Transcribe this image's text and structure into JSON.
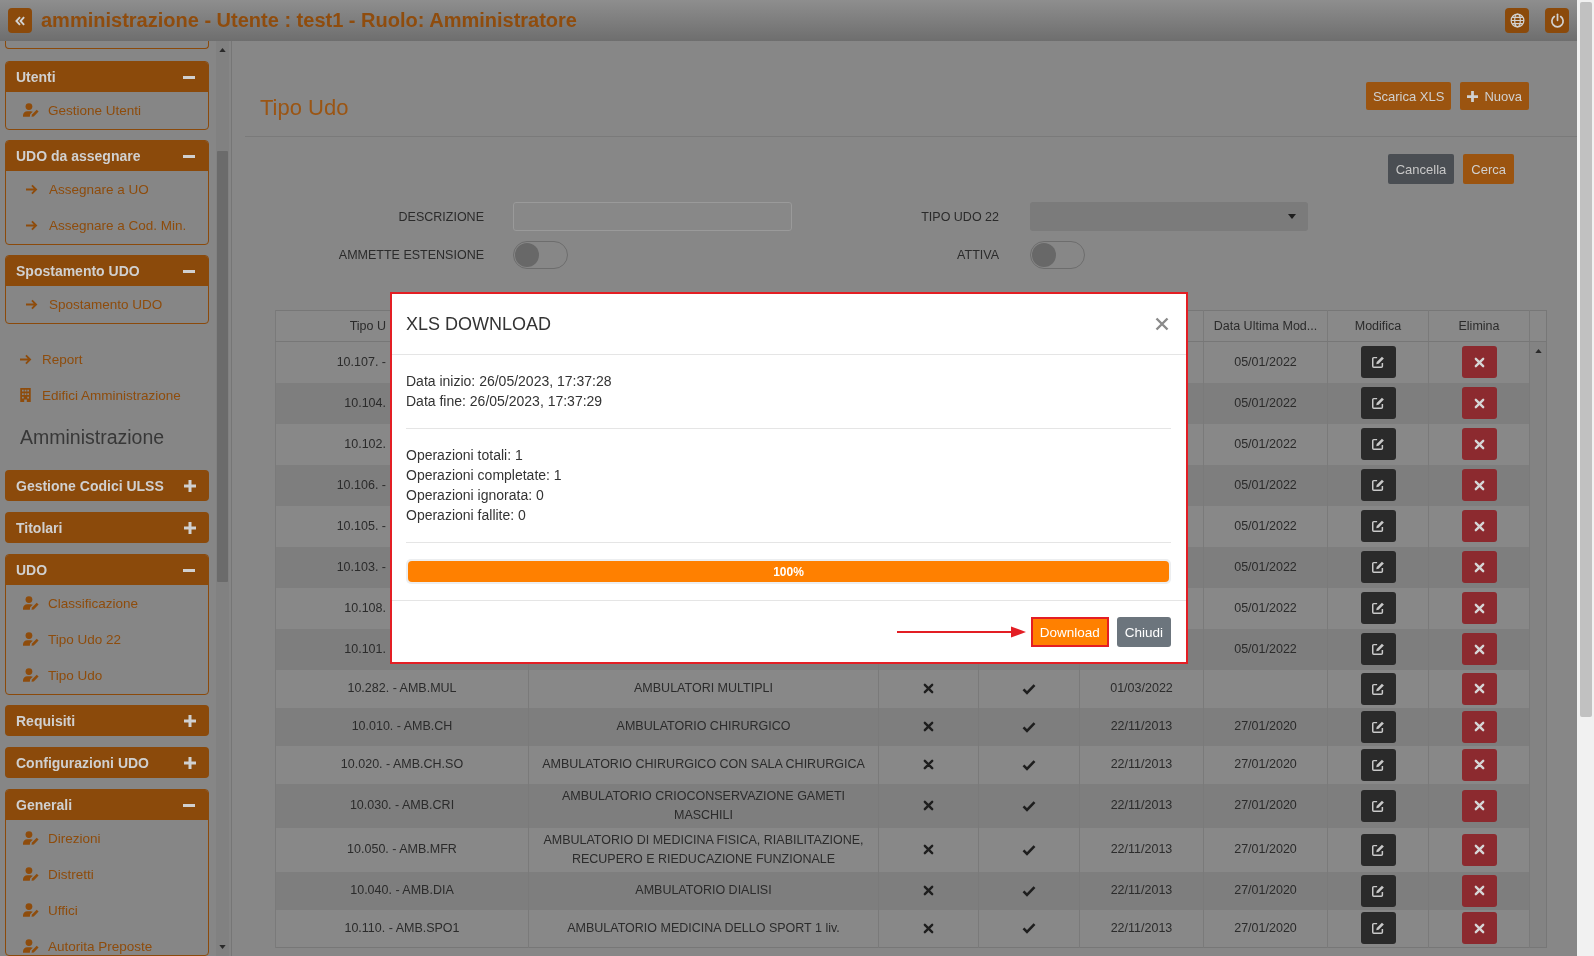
{
  "top_bar": {
    "title": "amministrazione - Utente : test1 - Ruolo: Amministratore"
  },
  "sidebar": {
    "items": [
      {
        "kind": "panel-end"
      },
      {
        "kind": "panel",
        "title": "Utenti",
        "expanded": true,
        "items": [
          {
            "kind": "person",
            "label": "Gestione Utenti"
          }
        ]
      },
      {
        "kind": "panel",
        "title": "UDO da assegnare",
        "expanded": true,
        "items": [
          {
            "kind": "arrow",
            "label": "Assegnare a UO"
          },
          {
            "kind": "arrow",
            "label": "Assegnare a Cod. Min."
          }
        ]
      },
      {
        "kind": "panel",
        "title": "Spostamento UDO",
        "expanded": true,
        "items": [
          {
            "kind": "arrow",
            "label": "Spostamento UDO"
          }
        ]
      },
      {
        "kind": "arrow-link",
        "label": "Report"
      },
      {
        "kind": "building-link",
        "label": "Edifici Amministrazione"
      },
      {
        "kind": "heading",
        "text": "Amministrazione"
      },
      {
        "kind": "panel",
        "title": "Gestione Codici ULSS",
        "expanded": false
      },
      {
        "kind": "panel",
        "title": "Titolari",
        "expanded": false
      },
      {
        "kind": "panel",
        "title": "UDO",
        "expanded": true,
        "items": [
          {
            "kind": "person",
            "label": "Classificazione"
          },
          {
            "kind": "person",
            "label": "Tipo Udo 22"
          },
          {
            "kind": "person",
            "label": "Tipo Udo"
          }
        ]
      },
      {
        "kind": "panel",
        "title": "Requisiti",
        "expanded": false
      },
      {
        "kind": "panel",
        "title": "Configurazioni UDO",
        "expanded": false
      },
      {
        "kind": "panel",
        "title": "Generali",
        "expanded": true,
        "items": [
          {
            "kind": "person",
            "label": "Direzioni"
          },
          {
            "kind": "person",
            "label": "Distretti"
          },
          {
            "kind": "person",
            "label": "Uffici"
          },
          {
            "kind": "person",
            "label": "Autorita Preposte"
          }
        ]
      }
    ]
  },
  "main": {
    "title": "Tipo Udo",
    "actions": [
      {
        "kind": "plain",
        "label": "Scarica XLS"
      },
      {
        "kind": "add",
        "label": "Nuova"
      }
    ],
    "filter_buttons": [
      {
        "kind": "secondary",
        "label": "Cancella"
      },
      {
        "kind": "primary",
        "label": "Cerca"
      }
    ],
    "filters": [
      {
        "kind": "text",
        "label": "DESCRIZIONE"
      },
      {
        "kind": "select",
        "label": "TIPO UDO 22"
      },
      {
        "kind": "toggle",
        "label": "AMMETTE ESTENSIONE",
        "on": false
      },
      {
        "kind": "toggle",
        "label": "ATTIVA",
        "on": false
      }
    ],
    "table": {
      "columns": [
        {
          "kind": "cut",
          "label": "Tipo U"
        },
        {
          "kind": "covered"
        },
        {
          "kind": "covered"
        },
        {
          "kind": "covered"
        },
        {
          "kind": "covered"
        },
        {
          "kind": "text",
          "label": "Data Ultima Mod..."
        },
        {
          "kind": "text",
          "label": "Modifica"
        },
        {
          "kind": "text",
          "label": "Elimina"
        }
      ],
      "rows": [
        {
          "kind": "behind-dialog",
          "column_1": "10.107. -",
          "column_6": "05/01/2022"
        },
        {
          "kind": "behind-dialog",
          "column_1": "10.104.",
          "column_6": "05/01/2022"
        },
        {
          "kind": "behind-dialog",
          "column_1": "10.102.",
          "column_6": "05/01/2022"
        },
        {
          "kind": "behind-dialog",
          "column_1": "10.106. -",
          "column_6": "05/01/2022"
        },
        {
          "kind": "behind-dialog",
          "column_1": "10.105. -",
          "column_6": "05/01/2022"
        },
        {
          "kind": "behind-dialog",
          "column_1": "10.103. -",
          "column_6": "05/01/2022"
        },
        {
          "kind": "behind-dialog",
          "column_1": "10.108.",
          "column_6": "05/01/2022"
        },
        {
          "kind": "behind-dialog",
          "column_1": "10.101.",
          "column_6": "05/01/2022"
        },
        {
          "kind": "full",
          "column_1": "10.282. - AMB.MUL",
          "column_2": "AMBULATORI MULTIPLI",
          "column_3": false,
          "column_4": true,
          "column_5": "01/03/2022"
        },
        {
          "kind": "full",
          "column_1": "10.010. - AMB.CH",
          "column_2": "AMBULATORIO CHIRURGICO",
          "column_3": false,
          "column_4": true,
          "column_5": "22/11/2013",
          "column_6": "27/01/2020"
        },
        {
          "kind": "full",
          "column_1": "10.020. - AMB.CH.SO",
          "column_2": "AMBULATORIO CHIRURGICO CON SALA CHIRURGICA",
          "column_3": false,
          "column_4": true,
          "column_5": "22/11/2013",
          "column_6": "27/01/2020"
        },
        {
          "kind": "full",
          "column_1": "10.030. - AMB.CRI",
          "column_2": "AMBULATORIO CRIOCONSERVAZIONE GAMETI MASCHILI",
          "column_3": false,
          "column_4": true,
          "column_5": "22/11/2013",
          "column_6": "27/01/2020"
        },
        {
          "kind": "full",
          "column_1": "10.050. - AMB.MFR",
          "column_2": "AMBULATORIO DI MEDICINA FISICA, RIABILITAZIONE, RECUPERO E RIEDUCAZIONE FUNZIONALE",
          "column_3": false,
          "column_4": true,
          "column_5": "22/11/2013",
          "column_6": "27/01/2020"
        },
        {
          "kind": "full",
          "column_1": "10.040. - AMB.DIA",
          "column_2": "AMBULATORIO DIALISI",
          "column_3": false,
          "column_4": true,
          "column_5": "22/11/2013",
          "column_6": "27/01/2020"
        },
        {
          "kind": "full",
          "column_1": "10.110. - AMB.SPO1",
          "column_2": "AMBULATORIO MEDICINA DELLO SPORT 1 liv.",
          "column_3": false,
          "column_4": true,
          "column_5": "22/11/2013",
          "column_6": "27/01/2020"
        }
      ]
    }
  },
  "dialog": {
    "title": "XLS DOWNLOAD",
    "highlighted": true,
    "times": [
      "Data inizio: 26/05/2023, 17:37:28",
      "Data fine: 26/05/2023, 17:37:29"
    ],
    "stats": [
      "Operazioni totali: 1",
      "Operazioni completate: 1",
      "Operazioni ignorata: 0",
      "Operazioni fallite: 0"
    ],
    "progress": {
      "level": 1,
      "label": "100%"
    },
    "buttons": [
      {
        "kind": "primary",
        "label": "Download",
        "highlighted": true
      },
      {
        "kind": "secondary",
        "label": "Chiudi",
        "highlighted": false
      }
    ]
  }
}
